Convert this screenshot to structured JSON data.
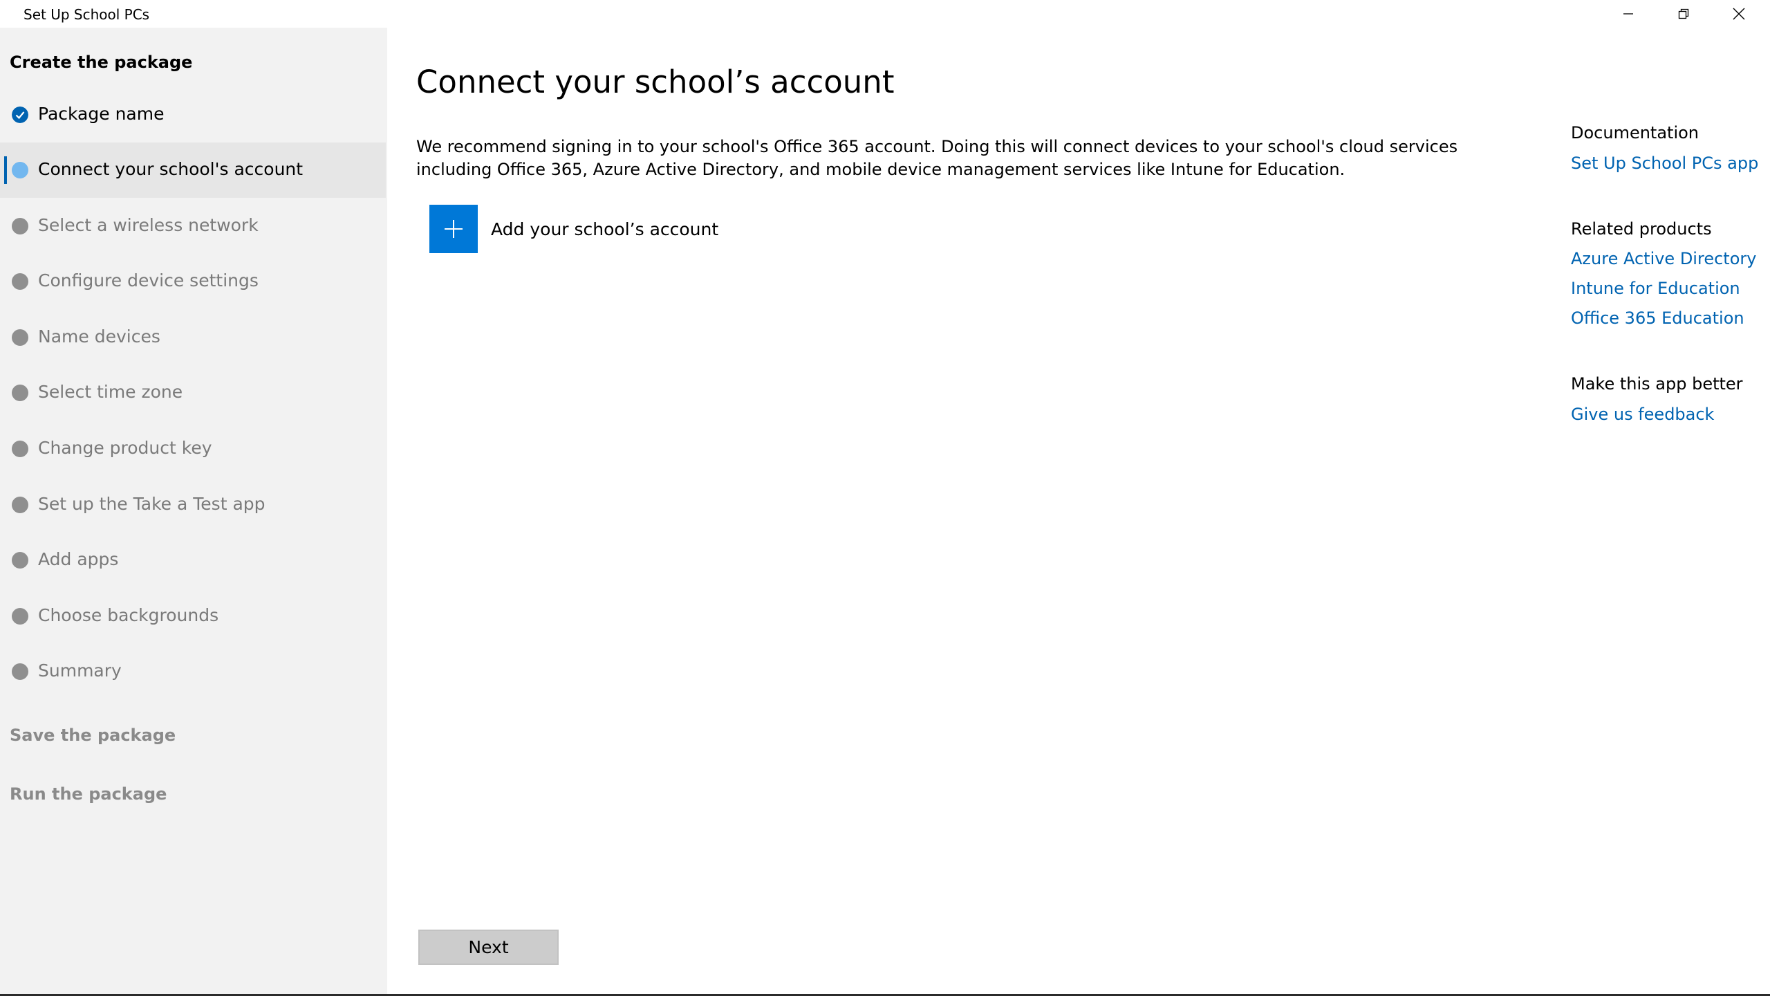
{
  "window": {
    "title": "Set Up School PCs",
    "controls": [
      "minimize-icon",
      "restore-icon",
      "close-icon"
    ]
  },
  "sidebar": {
    "create_heading": "Create the package",
    "steps": [
      {
        "label": "Package name",
        "state": "done",
        "icon": "checkmark-circle-icon"
      },
      {
        "label": "Connect your school's account",
        "state": "current"
      },
      {
        "label": "Select a wireless network",
        "state": "pending"
      },
      {
        "label": "Configure device settings",
        "state": "pending"
      },
      {
        "label": "Name devices",
        "state": "pending"
      },
      {
        "label": "Select time zone",
        "state": "pending"
      },
      {
        "label": "Change product key",
        "state": "pending"
      },
      {
        "label": "Set up the Take a Test app",
        "state": "pending"
      },
      {
        "label": "Add apps",
        "state": "pending"
      },
      {
        "label": "Choose backgrounds",
        "state": "pending"
      },
      {
        "label": "Summary",
        "state": "pending"
      }
    ],
    "save_heading": "Save the package",
    "run_heading": "Run the package"
  },
  "main": {
    "title": "Connect your school’s account",
    "intro": "We recommend signing in to your school's Office 365 account. Doing this will connect devices to your school's cloud services including Office 365, Azure Active Directory, and mobile device management services like Intune for Education.",
    "add_account_label": "Add your school’s account",
    "next_label": "Next"
  },
  "side_panel": {
    "documentation_heading": "Documentation",
    "documentation_link": "Set Up School PCs app",
    "related_heading": "Related products",
    "related_links": [
      "Azure Active Directory",
      "Intune for Education",
      "Office 365 Education"
    ],
    "feedback_heading": "Make this app better",
    "feedback_link": "Give us feedback"
  },
  "colors": {
    "accent": "#0078d7",
    "link": "#0063b1",
    "current_step": "#72b7ef",
    "pending_step": "#8f8f8f",
    "sidebar_bg": "#f2f2f2"
  }
}
